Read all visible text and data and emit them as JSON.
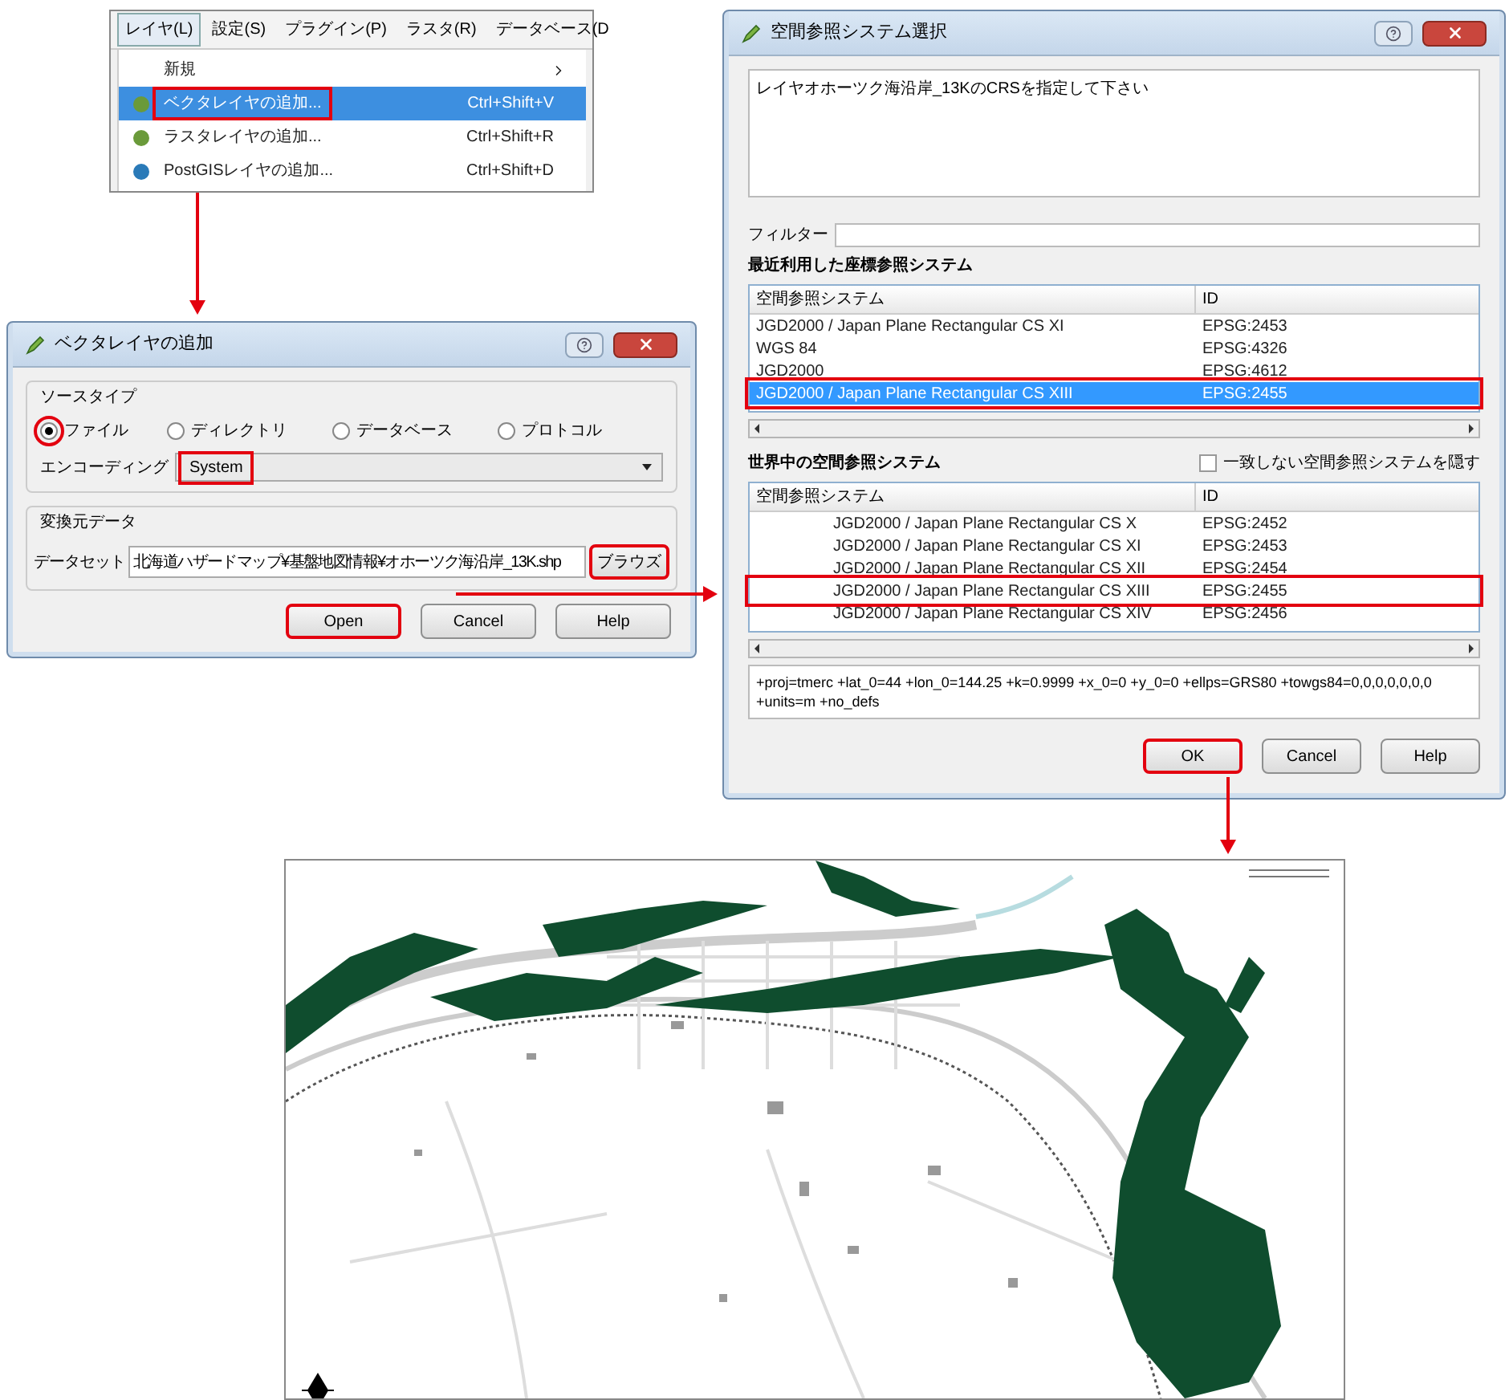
{
  "menu_window": {
    "menubar": [
      {
        "label": "レイヤ(L)",
        "selected": true
      },
      {
        "label": "設定(S)",
        "selected": false
      },
      {
        "label": "プラグイン(P)",
        "selected": false
      },
      {
        "label": "ラスタ(R)",
        "selected": false
      },
      {
        "label": "データベース(D",
        "selected": false
      }
    ],
    "items": [
      {
        "kind": "submenu",
        "label": "新規",
        "selected": false,
        "highlighted": false
      },
      {
        "kind": "action",
        "label": "ベクタレイヤの追加...",
        "shortcut": "Ctrl+Shift+V",
        "selected": true,
        "highlighted": true
      },
      {
        "kind": "action",
        "label": "ラスタレイヤの追加...",
        "shortcut": "Ctrl+Shift+R",
        "selected": false,
        "highlighted": false
      },
      {
        "kind": "action",
        "label": "PostGISレイヤの追加...",
        "shortcut": "Ctrl+Shift+D",
        "selected": false,
        "highlighted": false
      }
    ]
  },
  "vector_dialog": {
    "title": "ベクタレイヤの追加",
    "source_group": "ソースタイプ",
    "source_types": [
      {
        "label": "ファイル",
        "selected": true,
        "highlighted": true
      },
      {
        "label": "ディレクトリ",
        "selected": false,
        "highlighted": false
      },
      {
        "label": "データベース",
        "selected": false,
        "highlighted": false
      },
      {
        "label": "プロトコル",
        "selected": false,
        "highlighted": false
      }
    ],
    "encoding": {
      "label": "エンコーディング",
      "value": "System",
      "highlighted": true
    },
    "data_group": "変換元データ",
    "dataset": {
      "label": "データセット",
      "value": "北海道ハザードマップ¥基盤地図情報¥オホーツク海沿岸_13K.shp"
    },
    "browse": {
      "label": "ブラウズ",
      "highlighted": true
    },
    "buttons": [
      {
        "label": "Open",
        "highlighted": true
      },
      {
        "label": "Cancel",
        "highlighted": false
      },
      {
        "label": "Help",
        "highlighted": false
      }
    ]
  },
  "crs_dialog": {
    "title": "空間参照システム選択",
    "message": "レイヤオホーツク海沿岸_13KのCRSを指定して下さい",
    "filter_label": "フィルター",
    "recent_heading": "最近利用した座標参照システム",
    "recent_columns": [
      "空間参照システム",
      "ID"
    ],
    "recent_rows": [
      {
        "name": "JGD2000 / Japan Plane Rectangular CS XI",
        "id": "EPSG:2453",
        "selected": false,
        "highlighted": false
      },
      {
        "name": "WGS 84",
        "id": "EPSG:4326",
        "selected": false,
        "highlighted": false
      },
      {
        "name": "JGD2000",
        "id": "EPSG:4612",
        "selected": false,
        "highlighted": false
      },
      {
        "name": "JGD2000 / Japan Plane Rectangular CS XIII",
        "id": "EPSG:2455",
        "selected": true,
        "highlighted": true
      }
    ],
    "world_heading": "世界中の空間参照システム",
    "hide_checkbox": {
      "label": "一致しない空間参照システムを隠す",
      "checked": false
    },
    "world_columns": [
      "空間参照システム",
      "ID"
    ],
    "world_rows": [
      {
        "name": "JGD2000 / Japan Plane Rectangular CS X",
        "id": "EPSG:2452",
        "highlighted": false
      },
      {
        "name": "JGD2000 / Japan Plane Rectangular CS XI",
        "id": "EPSG:2453",
        "highlighted": false
      },
      {
        "name": "JGD2000 / Japan Plane Rectangular CS XII",
        "id": "EPSG:2454",
        "highlighted": false
      },
      {
        "name": "JGD2000 / Japan Plane Rectangular CS XIII",
        "id": "EPSG:2455",
        "highlighted": true
      },
      {
        "name": "JGD2000 / Japan Plane Rectangular CS XIV",
        "id": "EPSG:2456",
        "highlighted": false
      }
    ],
    "proj_string": "+proj=tmerc +lat_0=44 +lon_0=144.25 +k=0.9999 +x_0=0 +y_0=0 +ellps=GRS80 +towgs84=0,0,0,0,0,0,0 +units=m +no_defs",
    "buttons": [
      {
        "label": "OK",
        "highlighted": true
      },
      {
        "label": "Cancel",
        "highlighted": false
      },
      {
        "label": "Help",
        "highlighted": false
      }
    ]
  }
}
